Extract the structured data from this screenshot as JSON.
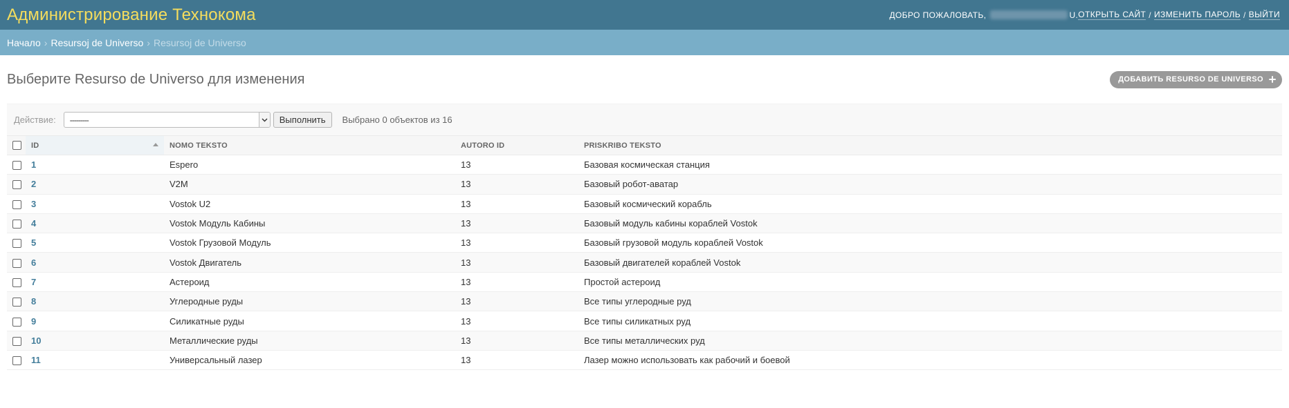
{
  "header": {
    "site_name": "Администрирование Технокома",
    "welcome": "ДОБРО ПОЖАЛОВАТЬ,",
    "username_suffix": "u.",
    "links": {
      "view_site": "ОТКРЫТЬ САЙТ",
      "change_password": "ИЗМЕНИТЬ ПАРОЛЬ",
      "logout": "ВЫЙТИ"
    },
    "sep": "/"
  },
  "breadcrumbs": {
    "home": "Начало",
    "app": "Resursoj de Universo",
    "current": "Resursoj de Universo",
    "arrow": "›"
  },
  "main": {
    "title": "Выберите Resurso de Universo для изменения",
    "add_button": "ДОБАВИТЬ RESURSO DE UNIVERSO"
  },
  "actions": {
    "label": "Действие:",
    "selected": "---------",
    "go": "Выполнить",
    "counter": "Выбрано 0 объектов из 16"
  },
  "table": {
    "columns": {
      "id": "ID",
      "nomo": "NOMO TEKSTO",
      "autoro": "AUTORO ID",
      "priskribo": "PRISKRIBO TEKSTO"
    },
    "rows": [
      {
        "id": "1",
        "nomo": "Espero",
        "autoro": "13",
        "priskribo": "Базовая космическая станция"
      },
      {
        "id": "2",
        "nomo": "V2M",
        "autoro": "13",
        "priskribo": "Базовый робот-аватар"
      },
      {
        "id": "3",
        "nomo": "Vostok U2",
        "autoro": "13",
        "priskribo": "Базовый космический корабль"
      },
      {
        "id": "4",
        "nomo": "Vostok Модуль Кабины",
        "autoro": "13",
        "priskribo": "Базовый модуль кабины кораблей Vostok"
      },
      {
        "id": "5",
        "nomo": "Vostok Грузовой Модуль",
        "autoro": "13",
        "priskribo": "Базовый грузовой модуль кораблей Vostok"
      },
      {
        "id": "6",
        "nomo": "Vostok Двигатель",
        "autoro": "13",
        "priskribo": "Базовый двигателей кораблей Vostok"
      },
      {
        "id": "7",
        "nomo": "Астероид",
        "autoro": "13",
        "priskribo": "Простой астероид"
      },
      {
        "id": "8",
        "nomo": "Углеродные руды",
        "autoro": "13",
        "priskribo": "Все типы углеродные руд"
      },
      {
        "id": "9",
        "nomo": "Силикатные руды",
        "autoro": "13",
        "priskribo": "Все типы силикатных руд"
      },
      {
        "id": "10",
        "nomo": "Металлические руды",
        "autoro": "13",
        "priskribo": "Все типы металлических руд"
      },
      {
        "id": "11",
        "nomo": "Универсальный лазер",
        "autoro": "13",
        "priskribo": "Лазер можно использовать как рабочий и боевой"
      }
    ]
  }
}
